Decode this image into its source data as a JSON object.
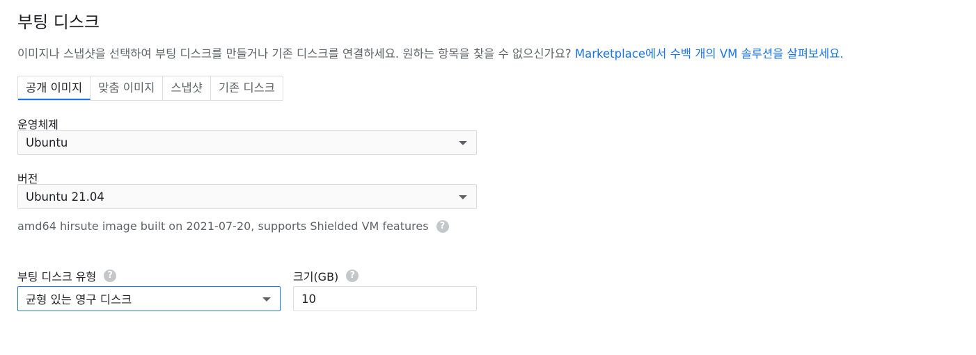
{
  "section": {
    "title": "부팅 디스크",
    "description": "이미지나 스냅샷을 선택하여 부팅 디스크를 만들거나 기존 디스크를 연결하세요. 원하는 항목을 찾을 수 없으신가요? ",
    "marketplace_link": "Marketplace에서 수백 개의 VM 솔루션을 살펴보세요."
  },
  "tabs": [
    {
      "label": "공개 이미지",
      "active": true
    },
    {
      "label": "맞춤 이미지",
      "active": false
    },
    {
      "label": "스냅샷",
      "active": false
    },
    {
      "label": "기존 디스크",
      "active": false
    }
  ],
  "os": {
    "label": "운영체제",
    "value": "Ubuntu"
  },
  "version": {
    "label": "버전",
    "value": "Ubuntu 21.04",
    "hint": "amd64 hirsute image built on 2021-07-20, supports Shielded VM features"
  },
  "disk_type": {
    "label": "부팅 디스크 유형",
    "value": "균형 있는 영구 디스크"
  },
  "size": {
    "label": "크기(GB)",
    "value": "10"
  },
  "icons": {
    "help": "?",
    "caret": "caret-down-icon"
  },
  "colors": {
    "accent": "#1a73e8",
    "text": "#202124",
    "secondary_text": "#5f6368",
    "border": "#dadce0",
    "help_icon": "#c4c7c9"
  }
}
